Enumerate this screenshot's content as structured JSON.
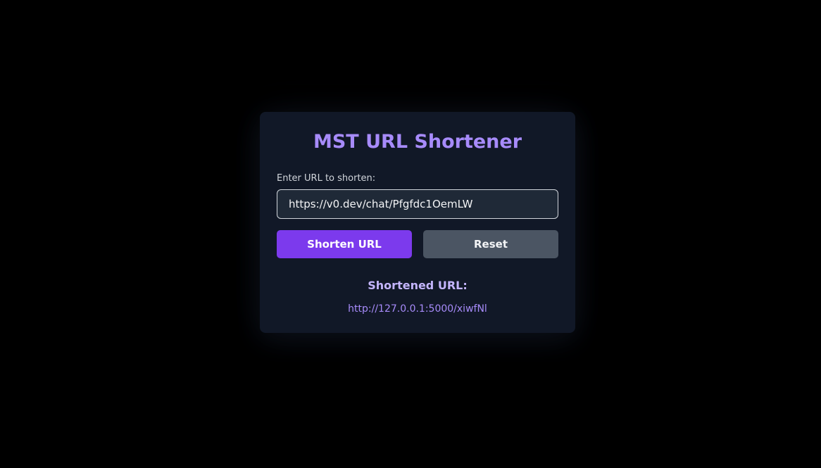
{
  "app": {
    "title": "MST URL Shortener"
  },
  "form": {
    "label": "Enter URL to shorten:",
    "url_value": "https://v0.dev/chat/Pfgfdc1OemLW",
    "shorten_label": "Shorten URL",
    "reset_label": "Reset"
  },
  "result": {
    "heading": "Shortened URL:",
    "short_url": "http://127.0.0.1:5000/xiwfNl"
  },
  "colors": {
    "background": "#000000",
    "card": "#111827",
    "accent": "#a78bfa",
    "primary_button": "#7c3aed",
    "secondary_button": "#4b5563"
  }
}
